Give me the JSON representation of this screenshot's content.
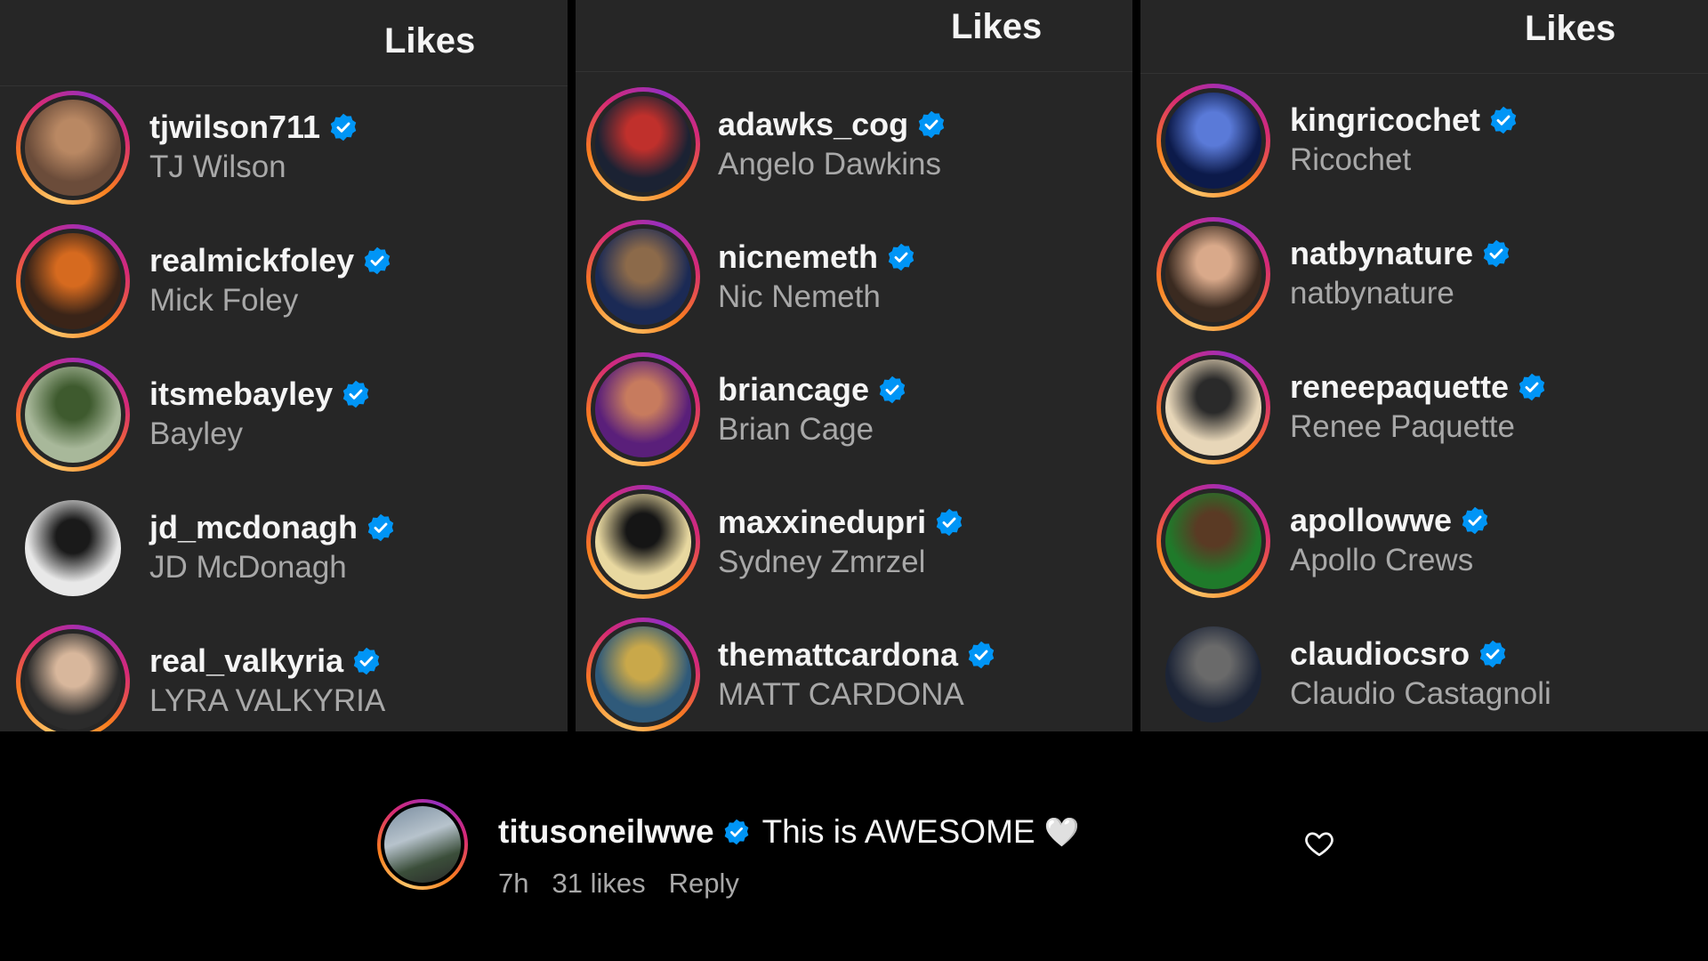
{
  "panels": [
    {
      "title": "Likes",
      "users": [
        {
          "username": "tjwilson711",
          "name": "TJ Wilson",
          "story_ring": true,
          "avatar_colors": [
            "#6b4c3a",
            "#b98863"
          ]
        },
        {
          "username": "realmickfoley",
          "name": "Mick Foley",
          "story_ring": true,
          "avatar_colors": [
            "#3a2418",
            "#d66a1f"
          ]
        },
        {
          "username": "itsmebayley",
          "name": "Bayley",
          "story_ring": true,
          "avatar_colors": [
            "#a8b89a",
            "#3e5a2e"
          ]
        },
        {
          "username": "jd_mcdonagh",
          "name": "JD McDonagh",
          "story_ring": false,
          "avatar_colors": [
            "#e8e8e8",
            "#1a1a1a"
          ]
        },
        {
          "username": "real_valkyria",
          "name": "LYRA VALKYRIA",
          "story_ring": true,
          "avatar_colors": [
            "#2b2b2b",
            "#d8b79c"
          ]
        }
      ]
    },
    {
      "title": "Likes",
      "users": [
        {
          "username": "adawks_cog",
          "name": "Angelo Dawkins",
          "story_ring": true,
          "avatar_colors": [
            "#1b2233",
            "#c0302c"
          ]
        },
        {
          "username": "nicnemeth",
          "name": "Nic Nemeth",
          "story_ring": true,
          "avatar_colors": [
            "#1b2a55",
            "#8c6a4a"
          ]
        },
        {
          "username": "briancage",
          "name": "Brian Cage",
          "story_ring": true,
          "avatar_colors": [
            "#5a1f7a",
            "#c77b5e"
          ]
        },
        {
          "username": "maxxinedupri",
          "name": "Sydney Zmrzel",
          "story_ring": true,
          "avatar_colors": [
            "#e8d8a0",
            "#151515"
          ]
        },
        {
          "username": "themattcardona",
          "name": "MATT CARDONA",
          "story_ring": true,
          "avatar_colors": [
            "#2f5a7a",
            "#c9a84a"
          ]
        }
      ]
    },
    {
      "title": "Likes",
      "users": [
        {
          "username": "kingricochet",
          "name": "Ricochet",
          "story_ring": true,
          "avatar_colors": [
            "#0c1a4a",
            "#5a7ad8"
          ]
        },
        {
          "username": "natbynature",
          "name": "natbynature",
          "story_ring": true,
          "avatar_colors": [
            "#3a2a20",
            "#d9a98a"
          ]
        },
        {
          "username": "reneepaquette",
          "name": "Renee Paquette",
          "story_ring": true,
          "avatar_colors": [
            "#e7d6b8",
            "#2a2a2a"
          ]
        },
        {
          "username": "apollowwe",
          "name": "Apollo Crews",
          "story_ring": true,
          "avatar_colors": [
            "#1f7a2a",
            "#5a3a24"
          ]
        },
        {
          "username": "claudiocsro",
          "name": "Claudio Castagnoli",
          "story_ring": false,
          "avatar_colors": [
            "#1c2436",
            "#6a6a6a"
          ]
        }
      ]
    }
  ],
  "comment": {
    "username": "titusoneilwwe",
    "text": "This is AWESOME",
    "emoji": "🤍",
    "time": "7h",
    "likes": "31 likes",
    "reply": "Reply"
  },
  "colors": {
    "panel_bg": "#262626",
    "page_bg": "#000000",
    "verified": "#0095f6",
    "secondary_text": "#a8a8a8"
  }
}
